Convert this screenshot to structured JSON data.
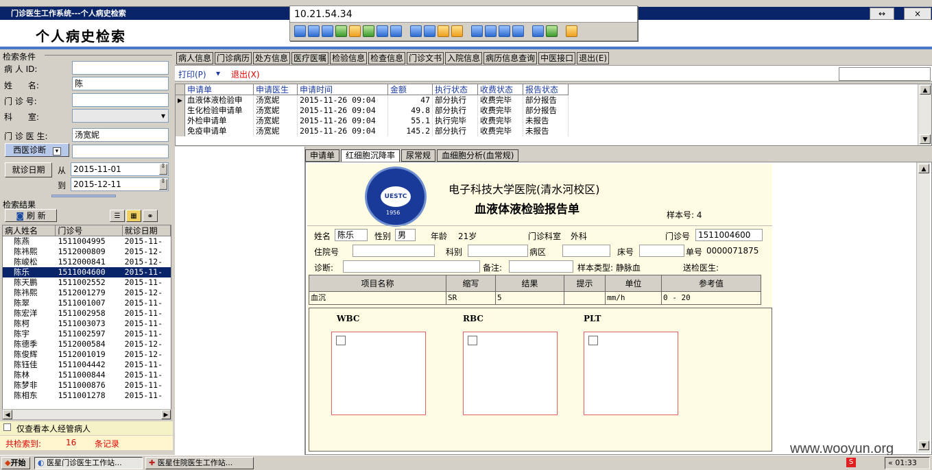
{
  "window": {
    "title": "门诊医生工作系统---个人病史检索",
    "header_title": "个人病史检索"
  },
  "remote": {
    "ip": "10.21.54.34"
  },
  "window_buttons": {
    "restore": "↔",
    "close": "×"
  },
  "search": {
    "section_label": "检索条件",
    "patient_id_label": "病 人 ID:",
    "patient_id_value": "",
    "name_label": "姓      名:",
    "name_value": "陈",
    "clinic_no_label": "门 诊 号:",
    "clinic_no_value": "",
    "dept_label": "科      室:",
    "dept_value": "",
    "doctor_label": "门 诊 医 生:",
    "doctor_value": "汤宽妮",
    "diag_type": "西医诊断",
    "diag_value": "",
    "visit_date_button": "就诊日期",
    "from_label": "从",
    "from_value": "2015-11-01",
    "to_label": "到",
    "to_value": "2015-12-11"
  },
  "results": {
    "section_label": "检索结果",
    "refresh_button": "刷 新",
    "columns": [
      "病人姓名",
      "门诊号",
      "就诊日期"
    ],
    "rows": [
      {
        "name": "陈燕",
        "no": "1511004995",
        "date": "2015-11-"
      },
      {
        "name": "陈祎熙",
        "no": "1512000809",
        "date": "2015-12-"
      },
      {
        "name": "陈峻松",
        "no": "1512000841",
        "date": "2015-12-"
      },
      {
        "name": "陈乐",
        "no": "1511004600",
        "date": "2015-11-"
      },
      {
        "name": "陈天鹏",
        "no": "1511002552",
        "date": "2015-11-"
      },
      {
        "name": "陈祎熙",
        "no": "1512001279",
        "date": "2015-12-"
      },
      {
        "name": "陈翠",
        "no": "1511001007",
        "date": "2015-11-"
      },
      {
        "name": "陈宏洋",
        "no": "1511002958",
        "date": "2015-11-"
      },
      {
        "name": "陈柯",
        "no": "1511003073",
        "date": "2015-11-"
      },
      {
        "name": "陈宇",
        "no": "1511002597",
        "date": "2015-11-"
      },
      {
        "name": "陈德季",
        "no": "1512000584",
        "date": "2015-12-"
      },
      {
        "name": "陈俊辉",
        "no": "1512001019",
        "date": "2015-12-"
      },
      {
        "name": "陈钰佳",
        "no": "1511004442",
        "date": "2015-11-"
      },
      {
        "name": "陈林",
        "no": "1511000844",
        "date": "2015-11-"
      },
      {
        "name": "陈梦非",
        "no": "1511000876",
        "date": "2015-11-"
      },
      {
        "name": "陈相东",
        "no": "1511001278",
        "date": "2015-11-"
      }
    ],
    "only_mine_label": "仅查看本人经管病人",
    "total_label": "共检索到:",
    "total_count": "16",
    "total_unit": "条记录"
  },
  "top_tabs": [
    "病人信息",
    "门诊病历",
    "处方信息",
    "医疗医嘱",
    "检验信息",
    "检查信息",
    "门诊文书",
    "入院信息",
    "病历信息查询",
    "中医接口",
    "退出(E)"
  ],
  "toolbar": {
    "print": "打印(P)",
    "exit": "退出(X)"
  },
  "requests": {
    "columns": [
      "申请单",
      "申请医生",
      "申请时间",
      "金额",
      "执行状态",
      "收费状态",
      "报告状态"
    ],
    "rows": [
      {
        "name": "血液体液检验申",
        "doctor": "汤宽妮",
        "time": "2015-11-26 09:04",
        "amount": "47",
        "exec": "部分执行",
        "fee": "收费完毕",
        "report": "部分报告"
      },
      {
        "name": "生化检验申请单",
        "doctor": "汤宽妮",
        "time": "2015-11-26 09:04",
        "amount": "49.8",
        "exec": "部分执行",
        "fee": "收费完毕",
        "report": "部分报告"
      },
      {
        "name": "外检申请单",
        "doctor": "汤宽妮",
        "time": "2015-11-26 09:04",
        "amount": "55.1",
        "exec": "执行完毕",
        "fee": "收费完毕",
        "report": "未报告"
      },
      {
        "name": "免疫申请单",
        "doctor": "汤宽妮",
        "time": "2015-11-26 09:04",
        "amount": "145.2",
        "exec": "部分执行",
        "fee": "收费完毕",
        "report": "未报告"
      }
    ]
  },
  "sub_tabs": [
    "申请单",
    "红细胞沉降率",
    "尿常规",
    "血细胞分析(血常规)"
  ],
  "report": {
    "hospital": "电子科技大学医院(清水河校区)",
    "title": "血液体液检验报告单",
    "sample_no": "样本号: 4",
    "logo_text": "UESTC",
    "logo_year": "1956",
    "name_label": "姓名",
    "name": "陈乐",
    "sex_label": "性别",
    "sex": "男",
    "age_label": "年龄",
    "age": "21岁",
    "dept_label": "门诊科室",
    "dept": "外科",
    "clinic_label": "门诊号",
    "clinic_no": "1511004600",
    "inpatient_label": "住院号",
    "inpatient": "",
    "ward_dept_label": "科别",
    "ward_dept": "",
    "area_label": "病区",
    "area": "",
    "bed_label": "床号",
    "bed": "",
    "slip_label": "单号",
    "slip_no": "0000071875",
    "diag_label": "诊断:",
    "diag": "",
    "remark_label": "备注:",
    "remark": "",
    "sample_type": "样本类型: 静脉血",
    "sender": "送检医生:",
    "table_cols": [
      "项目名称",
      "缩写",
      "结果",
      "提示",
      "单位",
      "参考值"
    ],
    "table_row": {
      "item": "血沉",
      "abbr": "SR",
      "result": "5",
      "hint": "",
      "unit": "mm/h",
      "ref": "0 - 20"
    },
    "charts": [
      "WBC",
      "RBC",
      "PLT"
    ]
  },
  "taskbar": {
    "start": "开始",
    "item1": "医星门诊医生工作站...",
    "item2": "医星住院医生工作站...",
    "clock": "« 01:33"
  },
  "watermark": "www.wooyun.org"
}
